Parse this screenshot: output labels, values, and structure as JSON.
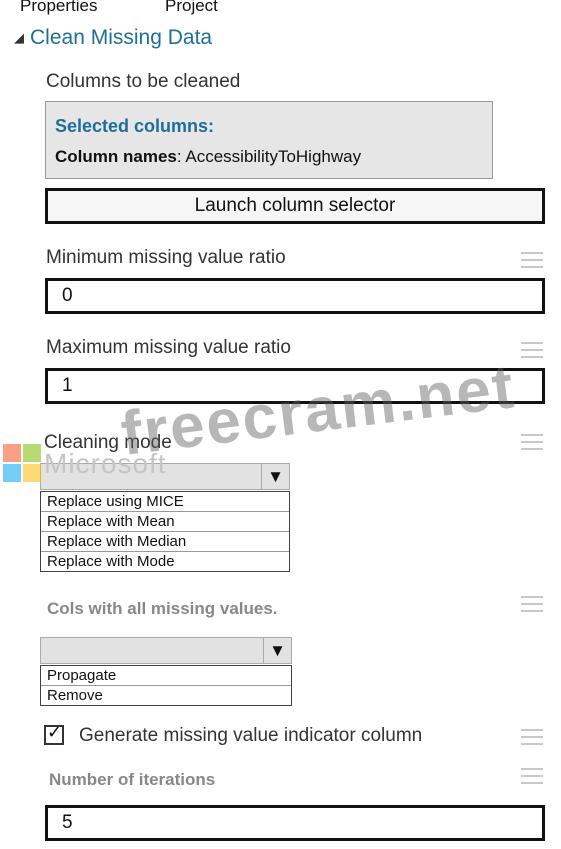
{
  "tabs": [
    "Properties",
    "Project"
  ],
  "section_title": "Clean Missing Data",
  "columns": {
    "label": "Columns to be cleaned",
    "selected_title": "Selected columns:",
    "names_key": "Column names",
    "names_value": ": AccessibilityToHighway",
    "button_label": "Launch column selector"
  },
  "min_ratio": {
    "label": "Minimum missing value ratio",
    "value": "0"
  },
  "max_ratio": {
    "label": "Maximum missing value ratio",
    "value": "1"
  },
  "cleaning_mode": {
    "label": "Cleaning mode",
    "selected": "",
    "options": [
      "Replace using MICE",
      "Replace with Mean",
      "Replace with Median",
      "Replace with Mode"
    ]
  },
  "cols_all_missing": {
    "label": "Cols with all missing values.",
    "selected": "",
    "options": [
      "Propagate",
      "Remove"
    ]
  },
  "generate_indicator": {
    "label": "Generate missing value indicator column",
    "checked": true
  },
  "iterations": {
    "label": "Number of iterations",
    "value": "5"
  },
  "watermark": {
    "logo_text": "Microsoft",
    "site_text": "freecram.net"
  },
  "colors": {
    "accent": "#1f6e99",
    "panel_bg": "#e6e6e6"
  }
}
